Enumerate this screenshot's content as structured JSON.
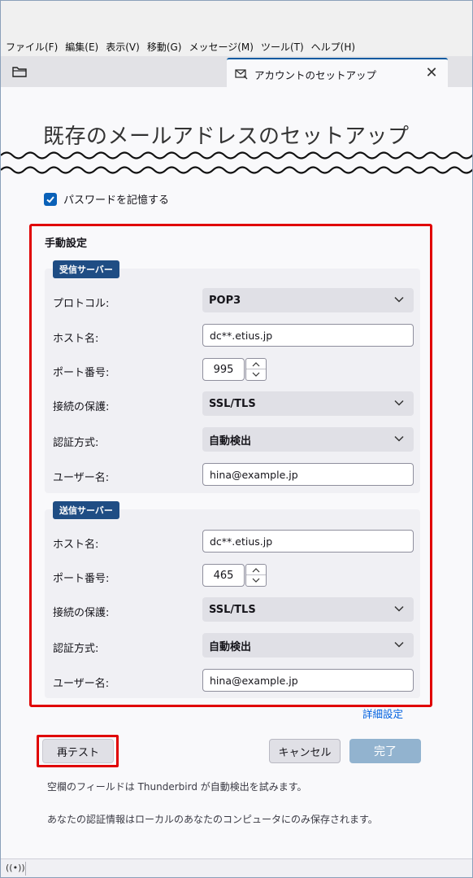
{
  "menubar": {
    "items": [
      "ファイル(F)",
      "編集(E)",
      "表示(V)",
      "移動(G)",
      "メッセージ(M)",
      "ツール(T)",
      "ヘルプ(H)"
    ]
  },
  "tabbar": {
    "tab_label": "アカウントのセットアップ",
    "close_glyph": "✕"
  },
  "page": {
    "title": "既存のメールアドレスのセットアップ",
    "remember_password": "パスワードを記憶する",
    "remember_checked": true
  },
  "manual": {
    "title": "手動設定",
    "incoming": {
      "badge": "受信サーバー",
      "protocol_label": "プロトコル:",
      "protocol_value": "POP3",
      "hostname_label": "ホスト名:",
      "hostname_value": "dc**.etius.jp",
      "port_label": "ポート番号:",
      "port_value": "995",
      "security_label": "接続の保護:",
      "security_value": "SSL/TLS",
      "auth_label": "認証方式:",
      "auth_value": "自動検出",
      "username_label": "ユーザー名:",
      "username_value": "hina@example.jp"
    },
    "outgoing": {
      "badge": "送信サーバー",
      "hostname_label": "ホスト名:",
      "hostname_value": "dc**.etius.jp",
      "port_label": "ポート番号:",
      "port_value": "465",
      "security_label": "接続の保護:",
      "security_value": "SSL/TLS",
      "auth_label": "認証方式:",
      "auth_value": "自動検出",
      "username_label": "ユーザー名:",
      "username_value": "hina@example.jp"
    },
    "advanced_link": "詳細設定"
  },
  "buttons": {
    "retest": "再テスト",
    "cancel": "キャンセル",
    "done": "完了"
  },
  "notes": {
    "autodetect": "空欄のフィールドは Thunderbird が自動検出を試みます。",
    "credentials": "あなたの認証情報はローカルのあなたのコンピュータにのみ保存されます。"
  },
  "statusbar": {
    "icon_glyph": "((•))"
  },
  "colors": {
    "accent_blue": "#0a61b8",
    "badge_blue": "#1f4d84",
    "highlight_red": "#e00000",
    "done_disabled": "#92b3cf",
    "link_blue": "#0061e0"
  }
}
